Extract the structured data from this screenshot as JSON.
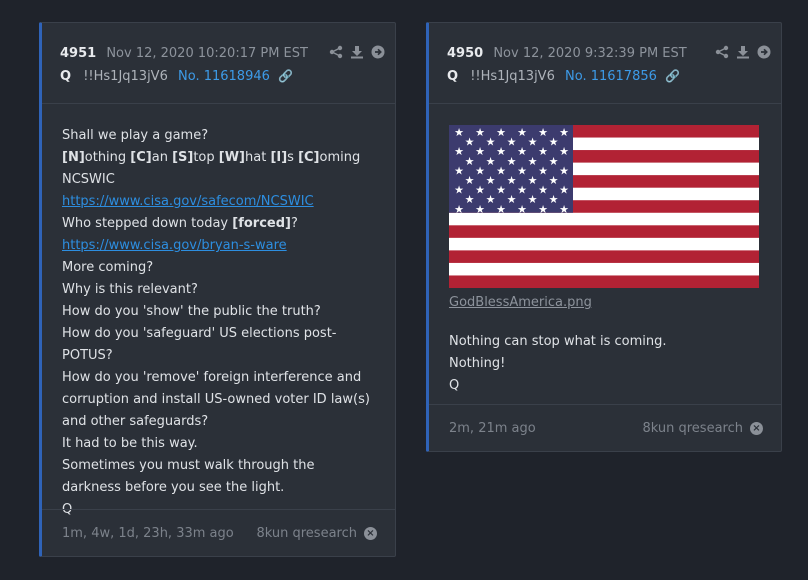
{
  "posts": [
    {
      "number": "4951",
      "date": "Nov 12, 2020 10:20:17 PM EST",
      "author": "Q",
      "tripcode": "!!Hs1Jq13jV6",
      "ref": "No. 11618946",
      "body": {
        "l1": "Shall we play a game?",
        "l2": [
          {
            "b": "[N]"
          },
          {
            "t": "othing "
          },
          {
            "b": "[C]"
          },
          {
            "t": "an "
          },
          {
            "b": "[S]"
          },
          {
            "t": "top "
          },
          {
            "b": "[W]"
          },
          {
            "t": "hat "
          },
          {
            "b": "[I]"
          },
          {
            "t": "s "
          },
          {
            "b": "[C]"
          },
          {
            "t": "oming"
          }
        ],
        "l3": "NCSWIC",
        "link1": "https://www.cisa.gov/safecom/NCSWIC",
        "l5_pre": "Who stepped down today ",
        "l5_bold": "[forced]",
        "l5_post": "?",
        "link2": "https://www.cisa.gov/bryan-s-ware",
        "l7": "More coming?",
        "l8": "Why is this relevant?",
        "l9": "How do you 'show' the public the truth?",
        "l10": "How do you 'safeguard' US elections post-POTUS?",
        "l11": "How do you 'remove' foreign interference and corruption and install US-owned voter ID law(s) and other safeguards?",
        "l12": "It had to be this way.",
        "l13": "Sometimes you must walk through the darkness before you see the light.",
        "l14": "Q"
      },
      "age": "1m, 4w, 1d, 23h, 33m ago",
      "source": "8kun qresearch"
    },
    {
      "number": "4950",
      "date": "Nov 12, 2020 9:32:39 PM EST",
      "author": "Q",
      "tripcode": "!!Hs1Jq13jV6",
      "ref": "No. 11617856",
      "image_file": "GodBlessAmerica.png",
      "body": {
        "l1": "Nothing can stop what is coming.",
        "l2": "Nothing!",
        "l3": "Q"
      },
      "age": "2m, 21m ago",
      "source": "8kun qresearch"
    }
  ],
  "icons": [
    "share-icon",
    "download-icon",
    "arrow-circle-icon",
    "link-icon",
    "close-circle-icon"
  ],
  "colors": {
    "accent": "#2f63b8",
    "link": "#2d8ee0",
    "background": "#1f232b",
    "card": "#2b3038"
  }
}
